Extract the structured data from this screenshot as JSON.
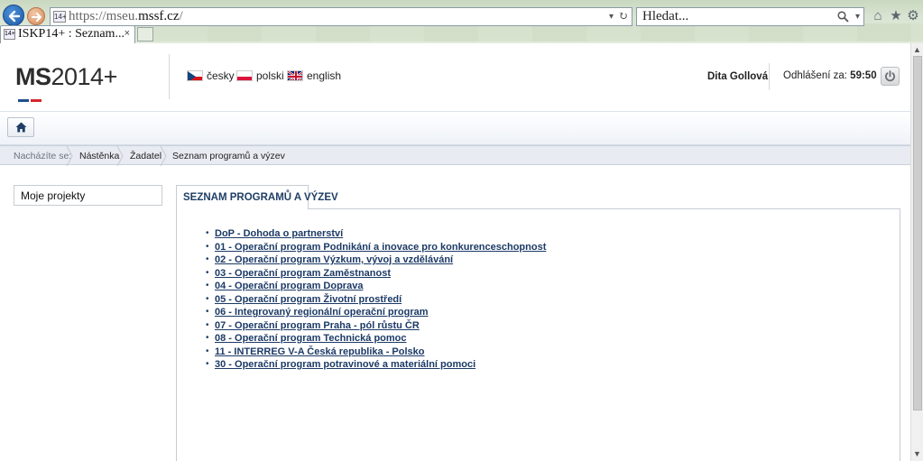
{
  "browser": {
    "url_prefix": "https://mseu.",
    "url_domain": "mssf.cz",
    "url_suffix": "/",
    "search_placeholder": "Hledat...",
    "tab_title": "ISKP14+ : Seznam...",
    "tab_close": "×",
    "favicon_text": "14+"
  },
  "header": {
    "logo_ms": "MS",
    "logo_rest": "2014+",
    "logo_colors": [
      "#1f4e8c",
      "#d6262b",
      "#9aa3ad"
    ],
    "languages": [
      {
        "label": "česky",
        "flag": "cz"
      },
      {
        "label": "polski",
        "flag": "pl"
      },
      {
        "label": "english",
        "flag": "gb"
      }
    ],
    "user_name": "Dita Gollová",
    "logout_label": "Odhlášení za:",
    "logout_time": "59:50"
  },
  "breadcrumb": {
    "prefix": "Nacházíte se:",
    "items": [
      "Nástěnka",
      "Žadatel",
      "Seznam programů a výzev"
    ]
  },
  "sidebar": {
    "items": [
      {
        "label": "Moje projekty"
      }
    ]
  },
  "main": {
    "tab_label": "SEZNAM PROGRAMŮ A VÝZEV",
    "programs": [
      "DoP - Dohoda o partnerství",
      "01 - Operační program Podnikání a inovace pro konkurenceschopnost",
      "02 - Operační program Výzkum, vývoj a vzdělávání",
      "03 - Operační program Zaměstnanost",
      "04 - Operační program Doprava",
      "05 - Operační program Životní prostředí",
      "06 - Integrovaný regionální operační program",
      "07 - Operační program Praha - pól růstu ČR",
      "08 - Operační program Technická pomoc",
      "11 - INTERREG V-A Česká republika - Polsko",
      "30 - Operační program potravinové a materiální pomoci"
    ]
  },
  "icons": {
    "back": "back-arrow-icon",
    "forward": "forward-arrow-icon",
    "home": "home-icon",
    "power": "power-icon",
    "search": "search-icon",
    "star": "star-icon",
    "gear": "gear-icon"
  }
}
